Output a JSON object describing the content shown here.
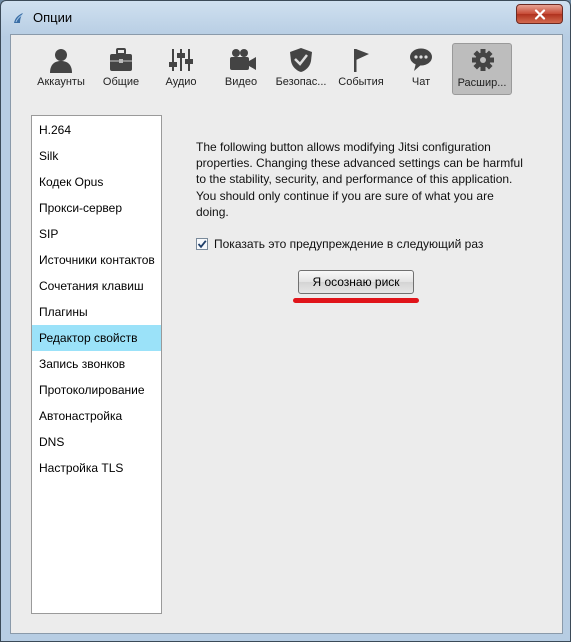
{
  "window": {
    "title": "Опции"
  },
  "toolbar": {
    "items": [
      {
        "label": "Аккаунты",
        "icon": "user-icon"
      },
      {
        "label": "Общие",
        "icon": "toolbox-icon"
      },
      {
        "label": "Аудио",
        "icon": "sliders-icon"
      },
      {
        "label": "Видео",
        "icon": "video-camera-icon"
      },
      {
        "label": "Безопас...",
        "icon": "shield-icon"
      },
      {
        "label": "События",
        "icon": "flag-icon"
      },
      {
        "label": "Чат",
        "icon": "speech-bubble-icon"
      },
      {
        "label": "Расшир...",
        "icon": "gear-icon"
      }
    ],
    "active_index": 7
  },
  "sidebar": {
    "items": [
      {
        "label": "H.264"
      },
      {
        "label": "Silk"
      },
      {
        "label": "Кодек Opus"
      },
      {
        "label": "Прокси-сервер"
      },
      {
        "label": "SIP"
      },
      {
        "label": "Источники контактов"
      },
      {
        "label": "Сочетания клавиш"
      },
      {
        "label": "Плагины"
      },
      {
        "label": "Редактор свойств"
      },
      {
        "label": "Запись звонков"
      },
      {
        "label": "Протоколирование"
      },
      {
        "label": "Автонастройка"
      },
      {
        "label": "DNS"
      },
      {
        "label": "Настройка TLS"
      }
    ],
    "selected_index": 8
  },
  "panel": {
    "warning_text": "The following button allows modifying Jitsi configuration properties. Changing these advanced settings can be harmful to the stability, security, and performance of this application. You should only continue if you are sure of what you are doing.",
    "checkbox_label": "Показать это предупреждение в следующий раз",
    "checkbox_checked": true,
    "button_label": "Я осознаю риск"
  },
  "colors": {
    "selection": "#9be2f9",
    "highlight_underline": "#e0141a",
    "close_button": "#c64a35"
  }
}
